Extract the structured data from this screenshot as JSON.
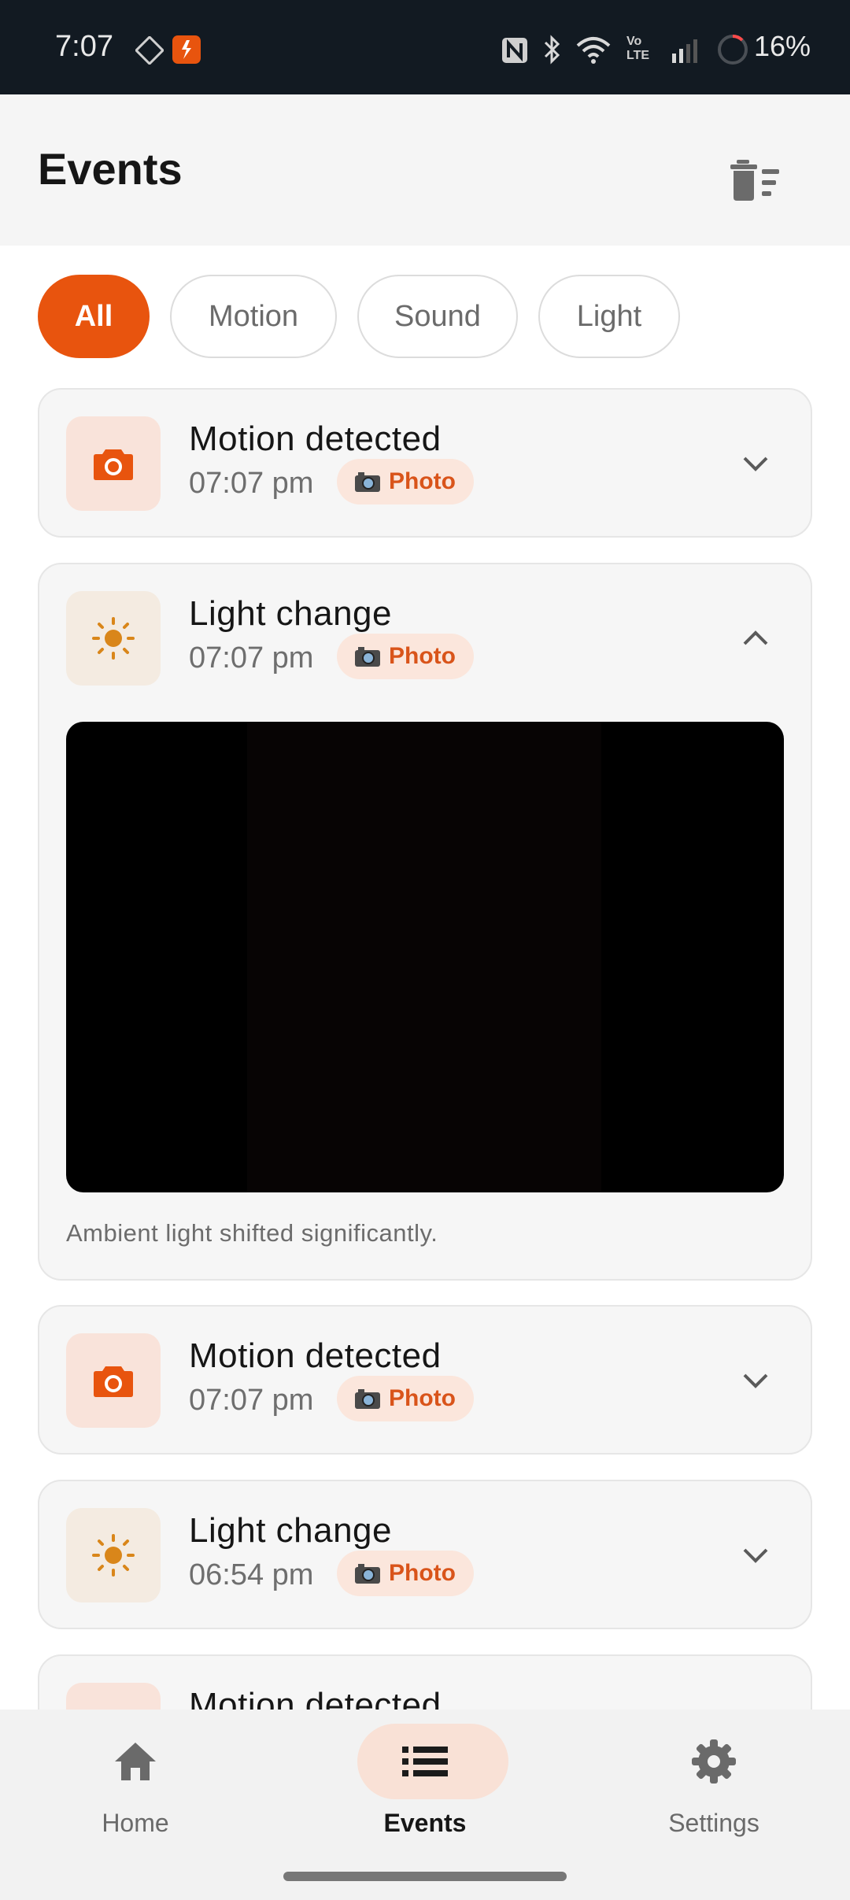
{
  "status_bar": {
    "time": "7:07",
    "battery": "16%"
  },
  "header": {
    "title": "Events"
  },
  "filters": [
    {
      "label": "All",
      "active": true
    },
    {
      "label": "Motion",
      "active": false
    },
    {
      "label": "Sound",
      "active": false
    },
    {
      "label": "Light",
      "active": false
    }
  ],
  "events": [
    {
      "title": "Motion detected",
      "time": "07:07 pm",
      "badge": "Photo",
      "type": "motion",
      "expanded": false
    },
    {
      "title": "Light change",
      "time": "07:07 pm",
      "badge": "Photo",
      "type": "light",
      "expanded": true,
      "note": "Ambient light shifted significantly."
    },
    {
      "title": "Motion detected",
      "time": "07:07 pm",
      "badge": "Photo",
      "type": "motion",
      "expanded": false
    },
    {
      "title": "Light change",
      "time": "06:54 pm",
      "badge": "Photo",
      "type": "light",
      "expanded": false
    },
    {
      "title": "Motion detected",
      "type": "motion",
      "expanded": false
    }
  ],
  "nav": [
    {
      "label": "Home",
      "icon": "home-icon",
      "active": false
    },
    {
      "label": "Events",
      "icon": "list-icon",
      "active": true
    },
    {
      "label": "Settings",
      "icon": "gear-icon",
      "active": false
    }
  ],
  "colors": {
    "accent": "#e8540e",
    "light_icon": "#d9861a"
  }
}
